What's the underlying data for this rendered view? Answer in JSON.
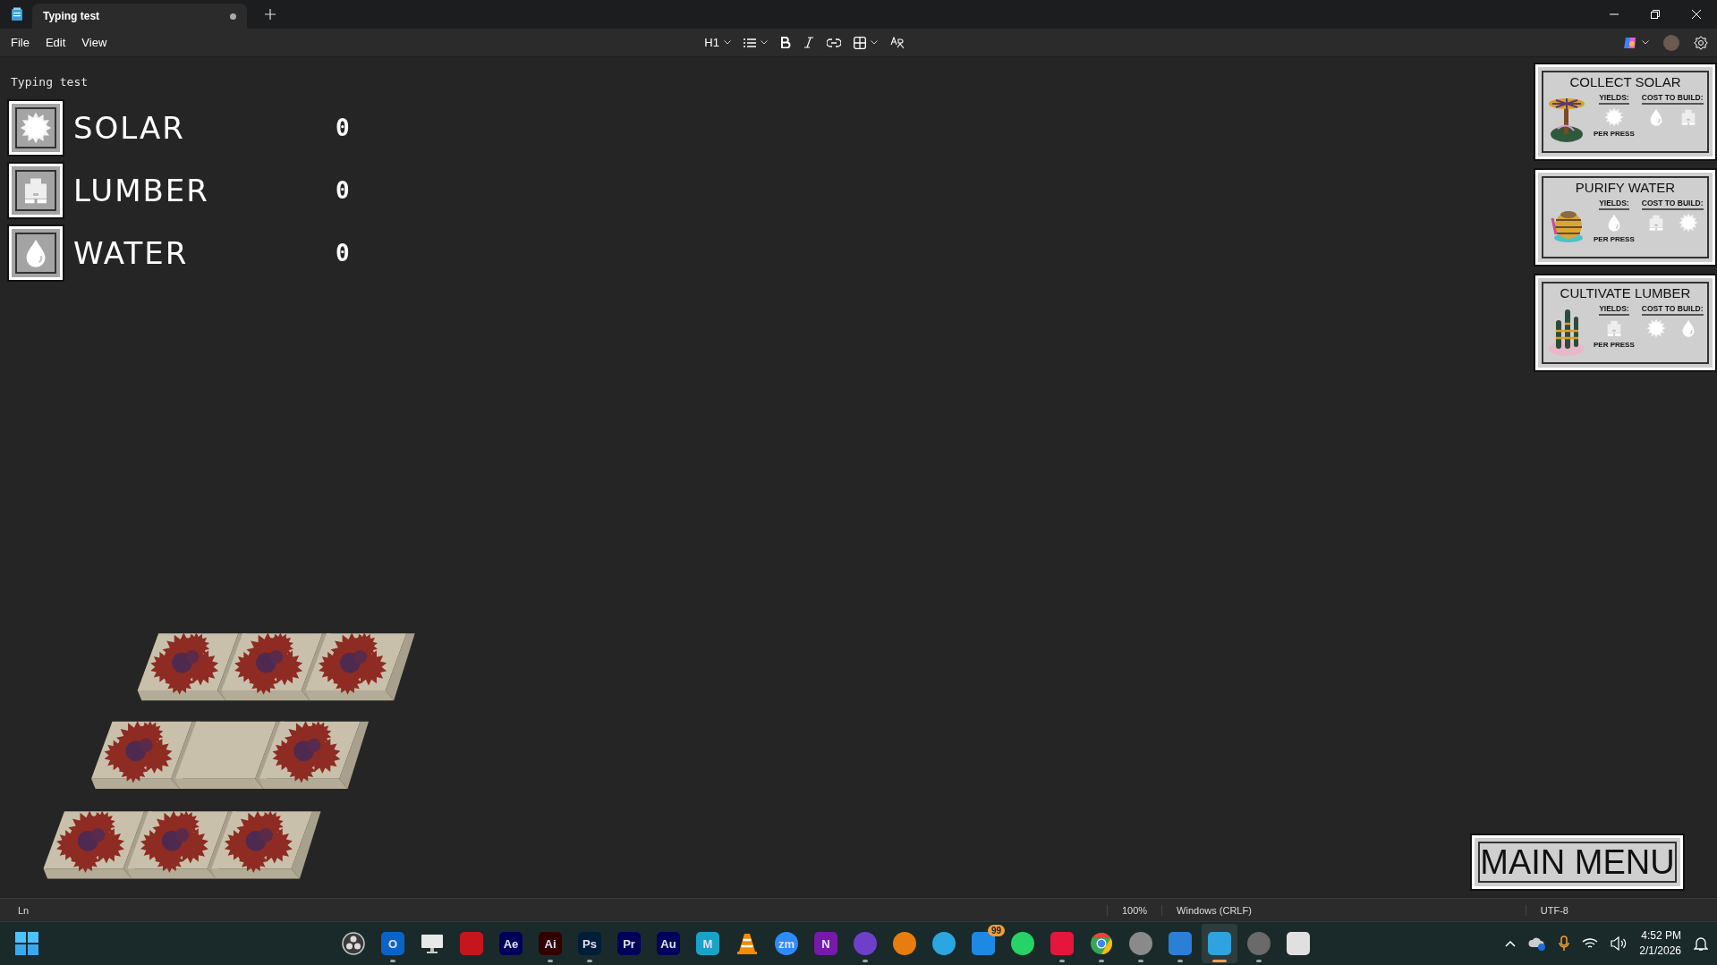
{
  "tab": {
    "title": "Typing test",
    "modified": true
  },
  "menu": [
    "File",
    "Edit",
    "View"
  ],
  "toolbar": {
    "heading": "H1"
  },
  "document": {
    "text": "Typing test"
  },
  "status_bar": {
    "position": "Ln",
    "zoom": "100%",
    "line_ending": "Windows (CRLF)",
    "encoding": "UTF-8"
  },
  "resources": [
    {
      "name": "SOLAR",
      "kind": "solar",
      "count": "0"
    },
    {
      "name": "LUMBER",
      "kind": "lumber",
      "count": "0"
    },
    {
      "name": "WATER",
      "kind": "water",
      "count": "0"
    }
  ],
  "cards": [
    {
      "title": "COLLECT SOLAR",
      "kind": "solar",
      "yields_label": "YIELDS:",
      "yields": {
        "kind": "solar"
      },
      "note": "PER PRESS",
      "cost_label": "COST TO BUILD:",
      "costs": [
        {
          "kind": "water"
        },
        {
          "kind": "lumber"
        }
      ]
    },
    {
      "title": "PURIFY WATER",
      "kind": "water",
      "yields_label": "YIELDS:",
      "yields": {
        "kind": "water"
      },
      "note": "PER PRESS",
      "cost_label": "COST TO BUILD:",
      "costs": [
        {
          "kind": "lumber"
        },
        {
          "kind": "solar"
        }
      ]
    },
    {
      "title": "CULTIVATE LUMBER",
      "kind": "lumber",
      "yields_label": "YIELDS:",
      "yields": {
        "kind": "lumber"
      },
      "note": "PER PRESS",
      "cost_label": "COST TO BUILD:",
      "costs": [
        {
          "kind": "solar"
        },
        {
          "kind": "water"
        }
      ]
    }
  ],
  "main_menu": {
    "label": "MAIN MENU"
  },
  "taskbar": {
    "apps": [
      {
        "kind": "ring",
        "color": "#3a3a3a",
        "running": false,
        "selected": false
      },
      {
        "kind": "tile",
        "color": "#0a64c8",
        "label": "O",
        "running": true,
        "selected": false
      },
      {
        "kind": "monitor",
        "color": "#e8e8e8",
        "running": false,
        "selected": false
      },
      {
        "kind": "tile",
        "color": "#c4161c",
        "running": false,
        "selected": false
      },
      {
        "kind": "tile",
        "color": "#00005b",
        "label": "Ae",
        "running": false,
        "selected": false
      },
      {
        "kind": "tile",
        "color": "#330000",
        "label": "Ai",
        "running": true,
        "selected": false
      },
      {
        "kind": "tile",
        "color": "#001e36",
        "label": "Ps",
        "running": true,
        "selected": false
      },
      {
        "kind": "tile",
        "color": "#00005b",
        "label": "Pr",
        "running": false,
        "selected": false
      },
      {
        "kind": "tile",
        "color": "#00005b",
        "label": "Au",
        "running": false,
        "selected": false
      },
      {
        "kind": "tile",
        "color": "#1aa3c7",
        "label": "M",
        "running": false,
        "selected": false
      },
      {
        "kind": "cone",
        "color": "#f48b00",
        "running": false,
        "selected": false
      },
      {
        "kind": "circle",
        "color": "#2d8cff",
        "label": "zm",
        "running": false,
        "selected": false
      },
      {
        "kind": "tile",
        "color": "#7719aa",
        "label": "N",
        "running": false,
        "selected": false
      },
      {
        "kind": "circle",
        "color": "#6e40c9",
        "running": true,
        "selected": false
      },
      {
        "kind": "circle",
        "color": "#e87d0d",
        "running": false,
        "selected": false
      },
      {
        "kind": "circle",
        "color": "#2aa6e0",
        "running": false,
        "selected": false
      },
      {
        "kind": "tile",
        "color": "#1e88e5",
        "badge": "99",
        "running": false,
        "selected": false
      },
      {
        "kind": "circle",
        "color": "#25d366",
        "running": false,
        "selected": false
      },
      {
        "kind": "tile",
        "color": "#e5153b",
        "running": true,
        "selected": false
      },
      {
        "kind": "chrome",
        "running": true,
        "selected": false
      },
      {
        "kind": "circle",
        "color": "#8a8a8a",
        "running": true,
        "selected": false
      },
      {
        "kind": "tile",
        "color": "#2b7fd6",
        "running": true,
        "selected": false
      },
      {
        "kind": "tile",
        "color": "#2ea3dd",
        "running": true,
        "selected": true
      },
      {
        "kind": "circle",
        "color": "#6a6a6a",
        "running": true,
        "selected": false
      },
      {
        "kind": "tile",
        "color": "#e0e0e0",
        "running": false,
        "selected": false
      }
    ],
    "tray": {
      "time": "4:52 PM",
      "date": "2/1/2026"
    }
  }
}
